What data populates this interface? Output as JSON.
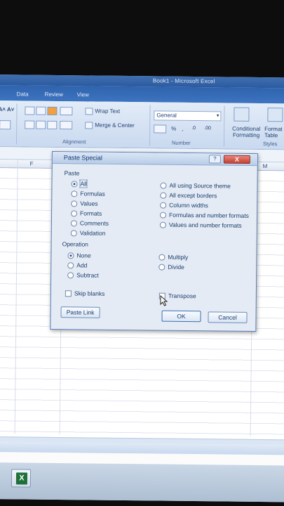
{
  "window": {
    "title": "Book1 - Microsoft Excel",
    "title_visible": "Book1 · Microsoft Excel"
  },
  "ribbon_tabs": [
    "Data",
    "Review",
    "View"
  ],
  "ribbon": {
    "font_size_buttons": "A˄ A˅",
    "wrap_text": "Wrap Text",
    "merge_center": "Merge & Center",
    "number_format": "General",
    "conditional_formatting": "Conditional Formatting",
    "format_as_table": "Format as Table",
    "groups": {
      "alignment": "Alignment",
      "number": "Number",
      "styles": "Styles"
    },
    "number_buttons": [
      "%",
      ",",
      ".0",
      ".00"
    ]
  },
  "columns": [
    "F",
    "M"
  ],
  "dialog": {
    "title": "Paste Special",
    "help": "?",
    "close": "X",
    "paste_section": "Paste",
    "paste_options_left": [
      {
        "label": "All",
        "selected": true
      },
      {
        "label": "Formulas",
        "selected": false
      },
      {
        "label": "Values",
        "selected": false
      },
      {
        "label": "Formats",
        "selected": false
      },
      {
        "label": "Comments",
        "selected": false
      },
      {
        "label": "Validation",
        "selected": false
      }
    ],
    "paste_options_right": [
      {
        "label": "All using Source theme",
        "selected": false
      },
      {
        "label": "All except borders",
        "selected": false
      },
      {
        "label": "Column widths",
        "selected": false
      },
      {
        "label": "Formulas and number formats",
        "selected": false
      },
      {
        "label": "Values and number formats",
        "selected": false
      }
    ],
    "operation_section": "Operation",
    "operation_left": [
      {
        "label": "None",
        "selected": true
      },
      {
        "label": "Add",
        "selected": false
      },
      {
        "label": "Subtract",
        "selected": false
      }
    ],
    "operation_right": [
      {
        "label": "Multiply",
        "selected": false
      },
      {
        "label": "Divide",
        "selected": false
      }
    ],
    "skip_blanks": {
      "label": "Skip blanks",
      "checked": false
    },
    "transpose": {
      "label": "Transpose",
      "checked": false
    },
    "paste_link": "Paste Link",
    "ok": "OK",
    "cancel": "Cancel"
  },
  "taskbar": {
    "excel_icon": "excel-icon",
    "excel_letter": "X"
  },
  "colors": {
    "ribbon_blue": "#2f63ad",
    "dialog_bg": "#e4ebf5",
    "close_red": "#c7402f",
    "excel_green": "#1f6f3a"
  }
}
